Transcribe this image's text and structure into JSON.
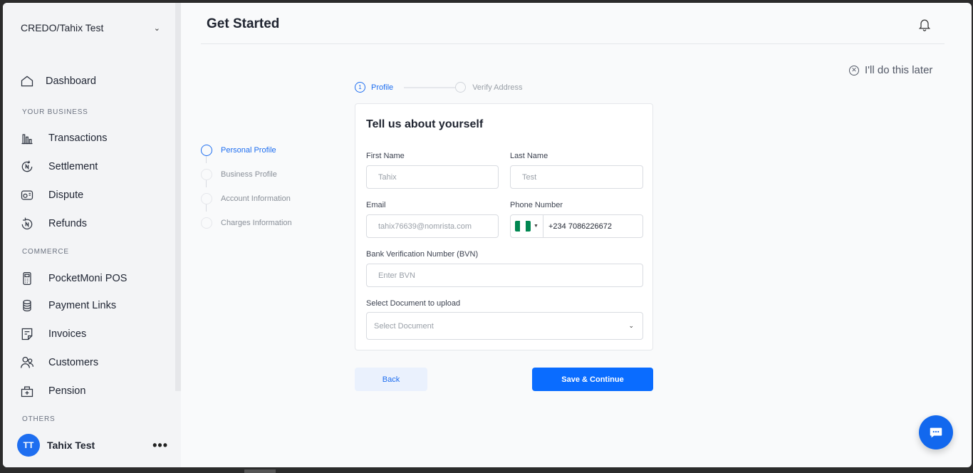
{
  "sidebar": {
    "org_name": "CREDO/Tahix Test",
    "dashboard": "Dashboard",
    "section_business": "YOUR BUSINESS",
    "transactions": "Transactions",
    "settlement": "Settlement",
    "dispute": "Dispute",
    "refunds": "Refunds",
    "section_commerce": "COMMERCE",
    "pos": "PocketMoni POS",
    "payment_links": "Payment Links",
    "invoices": "Invoices",
    "customers": "Customers",
    "pension": "Pension",
    "section_others": "OTHERS",
    "user_initials": "TT",
    "user_name": "Tahix Test"
  },
  "header": {
    "title": "Get Started",
    "skip_label": "I'll do this later"
  },
  "stepper": {
    "step1_num": "1",
    "step1_label": "Profile",
    "step2_label": "Verify Address"
  },
  "progress": {
    "personal": "Personal Profile",
    "business": "Business Profile",
    "account": "Account Information",
    "charges": "Charges Information"
  },
  "form": {
    "title": "Tell us about yourself",
    "first_name_label": "First Name",
    "first_name_value": "Tahix",
    "last_name_label": "Last Name",
    "last_name_value": "Test",
    "email_label": "Email",
    "email_value": "tahix76639@nomrista.com",
    "phone_label": "Phone Number",
    "phone_value": "+234 7086226672",
    "bvn_label": "Bank Verification Number (BVN)",
    "bvn_placeholder": "Enter BVN",
    "doc_label": "Select Document to upload",
    "doc_placeholder": "Select Document"
  },
  "actions": {
    "back": "Back",
    "save": "Save & Continue"
  },
  "colors": {
    "accent": "#0a6cff",
    "flag_green": "#008751"
  }
}
